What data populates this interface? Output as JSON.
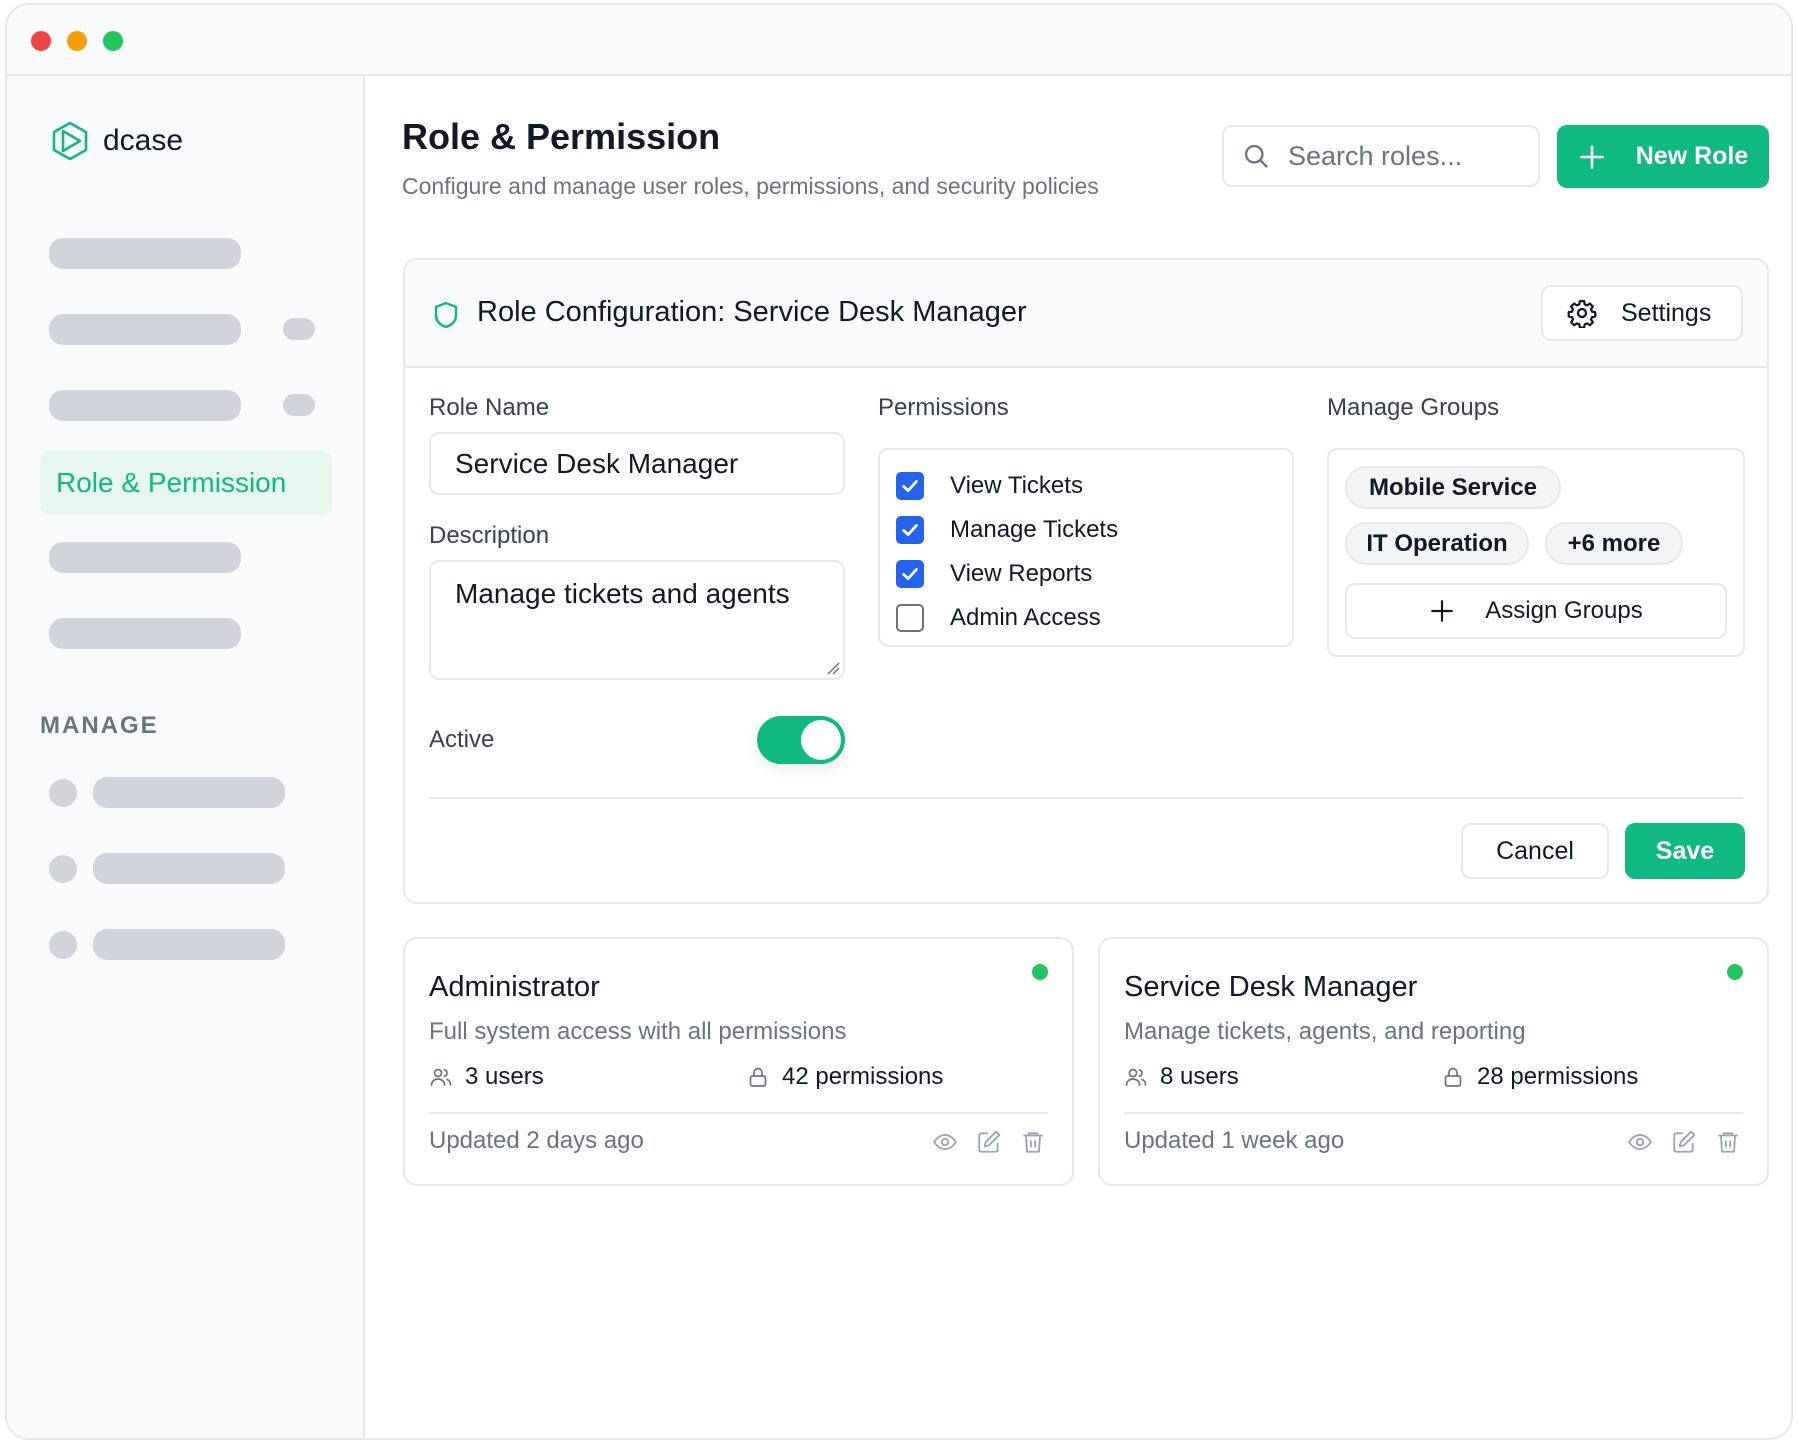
{
  "app": {
    "name": "dcase"
  },
  "sidebar": {
    "active_item": "Role & Permission",
    "section_label": "MANAGE"
  },
  "header": {
    "title": "Role & Permission",
    "subtitle": "Configure and manage user roles, permissions, and security policies",
    "search_placeholder": "Search roles...",
    "new_role_label": "New Role"
  },
  "config": {
    "title": "Role Configuration: Service Desk Manager",
    "settings_label": "Settings",
    "role_name_label": "Role Name",
    "role_name_value": "Service Desk Manager",
    "description_label": "Description",
    "description_value": "Manage tickets and agents",
    "active_label": "Active",
    "active": true,
    "permissions_label": "Permissions",
    "permissions": [
      {
        "label": "View Tickets",
        "checked": true
      },
      {
        "label": "Manage Tickets",
        "checked": true
      },
      {
        "label": "View Reports",
        "checked": true
      },
      {
        "label": "Admin Access",
        "checked": false
      }
    ],
    "groups_label": "Manage Groups",
    "groups": [
      "Mobile Service",
      "IT Operation",
      "+6 more"
    ],
    "assign_groups_label": "Assign Groups",
    "cancel_label": "Cancel",
    "save_label": "Save"
  },
  "roles": [
    {
      "name": "Administrator",
      "description": "Full system access with all permissions",
      "users": "3 users",
      "permissions": "42 permissions",
      "updated": "Updated 2 days ago",
      "status_color": "#22c55e"
    },
    {
      "name": "Service Desk Manager",
      "description": "Manage tickets, agents, and reporting",
      "users": "8 users",
      "permissions": "28 permissions",
      "updated": "Updated 1 week ago",
      "status_color": "#22c55e"
    }
  ],
  "colors": {
    "accent": "#10b981",
    "checkbox": "#2563eb",
    "status_active": "#22c55e"
  },
  "icons": [
    "dcase-logo-icon",
    "search-icon",
    "plus-icon",
    "shield-icon",
    "gear-icon",
    "check-icon",
    "users-icon",
    "lock-icon",
    "eye-icon",
    "edit-icon",
    "trash-icon"
  ]
}
